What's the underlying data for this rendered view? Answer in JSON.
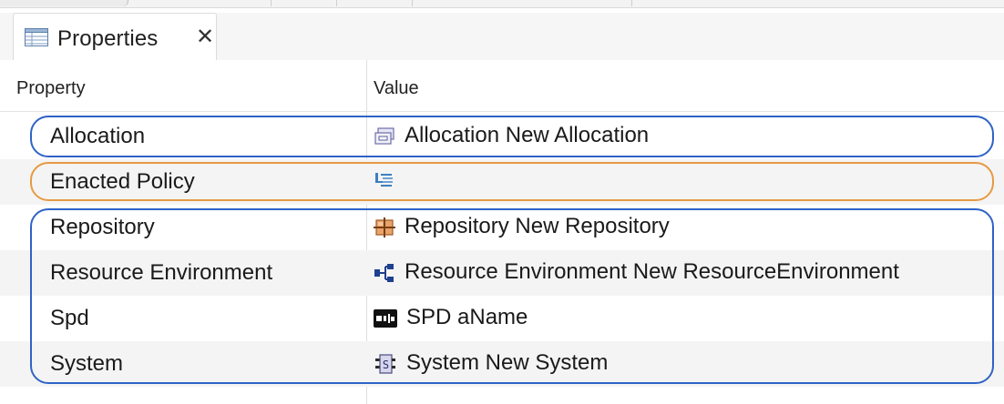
{
  "tab": {
    "title": "Properties",
    "icon": "properties-table-icon",
    "close_glyph": "✕"
  },
  "header": {
    "property": "Property",
    "value": "Value"
  },
  "rows": [
    {
      "property": "Allocation",
      "value": "Allocation New Allocation",
      "icon": "allocation-icon"
    },
    {
      "property": "Enacted Policy",
      "value": "",
      "icon": "enacted-policy-icon"
    },
    {
      "property": "Repository",
      "value": "Repository New Repository",
      "icon": "repository-icon"
    },
    {
      "property": "Resource Environment",
      "value": "Resource Environment New ResourceEnvironment",
      "icon": "resource-environment-icon"
    },
    {
      "property": "Spd",
      "value": "SPD aName",
      "icon": "spd-icon"
    },
    {
      "property": "System",
      "value": "System New System",
      "icon": "system-icon"
    }
  ],
  "colors": {
    "highlight_blue": "#2e63c7",
    "highlight_orange": "#e69a43"
  }
}
